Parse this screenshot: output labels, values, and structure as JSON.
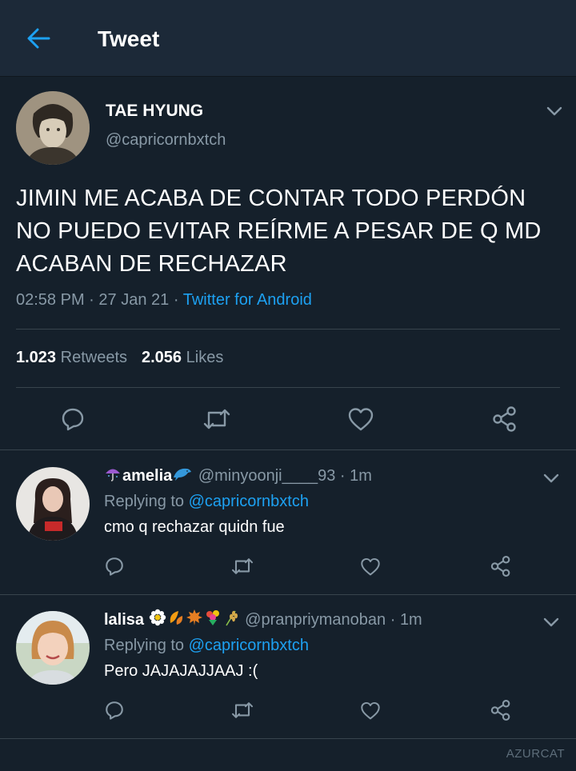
{
  "header": {
    "title": "Tweet"
  },
  "tweet": {
    "display_name": "TAE HYUNG",
    "handle": "@capricornbxtch",
    "text": "JIMIN ME ACABA DE CONTAR TODO PERDÓN NO PUEDO EVITAR REÍRME A PESAR DE Q MD ACABAN DE RECHAZAR",
    "time": "02:58 PM",
    "date": "27 Jan 21",
    "source": "Twitter for Android",
    "retweets_count": "1.023",
    "retweets_label": "Retweets",
    "likes_count": "2.056",
    "likes_label": "Likes"
  },
  "replies": [
    {
      "name": "amelia",
      "handle": "@minyoonji____93",
      "time": "1m",
      "replying_prefix": "Replying to",
      "replying_to": "@capricornbxtch",
      "text": "cmo q rechazar quidn fue"
    },
    {
      "name": "lalisa",
      "handle": "@pranpriymanoban",
      "time": "1m",
      "replying_prefix": "Replying to",
      "replying_to": "@capricornbxtch",
      "text": "Pero JAJAJAJJAAJ :("
    }
  ],
  "separator": "·",
  "watermark": "AZURCAT",
  "colors": {
    "background": "#15202b",
    "header": "#1c2938",
    "accent": "#1da1f2",
    "muted": "#8899a6",
    "divider": "#38444d"
  },
  "icons": [
    "back-arrow-icon",
    "chevron-down-icon",
    "reply-icon",
    "retweet-icon",
    "like-icon",
    "share-icon",
    "umbrella-emoji",
    "dolphin-emoji",
    "flower-emoji",
    "leaf-emoji",
    "maple-emoji",
    "bouquet-emoji",
    "wheat-emoji"
  ]
}
